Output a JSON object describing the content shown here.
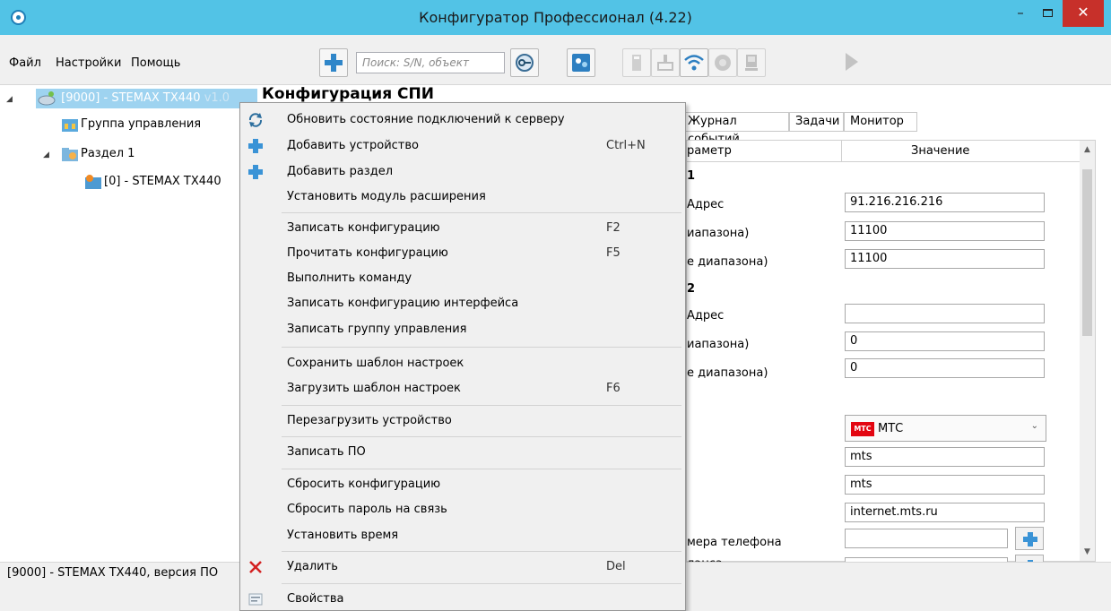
{
  "window": {
    "title": "Конфигуратор Профессионал (4.22)",
    "minimize": "–",
    "close": "✕"
  },
  "menu": {
    "file": "Файл",
    "settings": "Настройки",
    "help": "Помощь"
  },
  "toolbar": {
    "search_placeholder": "Поиск: S/N, объект"
  },
  "tree": {
    "root": "[9000] - STEMAX TX440",
    "root_version": "v1.0",
    "control_group": "Группа управления",
    "section": "Раздел 1",
    "device": "[0] - STEMAX TX440"
  },
  "main": {
    "title": "Конфигурация СПИ",
    "tabs": [
      "Журнал событий",
      "Задачи",
      "Монитор"
    ],
    "grid": {
      "col_param": "раметр",
      "col_value": "Значение",
      "rows": [
        {
          "param": "1",
          "bold": true,
          "value": ""
        },
        {
          "param": "Адрес",
          "value": "91.216.216.216"
        },
        {
          "param": "иапазона)",
          "value": "11100"
        },
        {
          "param": "е диапазона)",
          "value": "11100"
        },
        {
          "param": "2",
          "bold": true,
          "value": ""
        },
        {
          "param": "Адрес",
          "value": ""
        },
        {
          "param": "иапазона)",
          "value": "0"
        },
        {
          "param": "е диапазона)",
          "value": "0"
        },
        {
          "param": "",
          "value": "mts"
        },
        {
          "param": "",
          "value": "mts"
        },
        {
          "param": "",
          "value": "internet.mts.ru"
        },
        {
          "param": "мера телефона",
          "value": ""
        },
        {
          "param": "ланса",
          "value": ""
        }
      ],
      "operator": {
        "logo": "МТС",
        "label": "МТС"
      }
    }
  },
  "context_menu": {
    "items": [
      {
        "label": "Обновить состояние подключений к серверу",
        "shortcut": "",
        "icon": "refresh-icon"
      },
      {
        "label": "Добавить устройство",
        "shortcut": "Ctrl+N",
        "icon": "plus-icon"
      },
      {
        "label": "Добавить раздел",
        "shortcut": "",
        "icon": "plus-icon"
      },
      {
        "label": "Установить модуль расширения",
        "shortcut": ""
      },
      {
        "label": "Записать конфигурацию",
        "shortcut": "F2"
      },
      {
        "label": "Прочитать конфигурацию",
        "shortcut": "F5"
      },
      {
        "label": "Выполнить команду",
        "shortcut": ""
      },
      {
        "label": "Записать конфигурацию интерфейса",
        "shortcut": ""
      },
      {
        "label": "Записать группу управления",
        "shortcut": ""
      },
      {
        "label": "Сохранить шаблон настроек",
        "shortcut": ""
      },
      {
        "label": "Загрузить шаблон настроек",
        "shortcut": "F6"
      },
      {
        "label": "Перезагрузить устройство",
        "shortcut": ""
      },
      {
        "label": "Записать ПО",
        "shortcut": ""
      },
      {
        "label": "Сбросить конфигурацию",
        "shortcut": ""
      },
      {
        "label": "Сбросить пароль на связь",
        "shortcut": ""
      },
      {
        "label": "Установить время",
        "shortcut": ""
      },
      {
        "label": "Удалить",
        "shortcut": "Del",
        "icon": "delete-icon"
      },
      {
        "label": "Свойства",
        "shortcut": "",
        "icon": "properties-icon"
      }
    ]
  },
  "statusbar": {
    "text": "[9000] - STEMAX TX440, версия ПО"
  },
  "colors": {
    "titlebar": "#52c3e6",
    "close": "#c7302a",
    "selection": "#9ed3f0",
    "accent_blue": "#1e7fb8",
    "mts_red": "#e30611"
  }
}
